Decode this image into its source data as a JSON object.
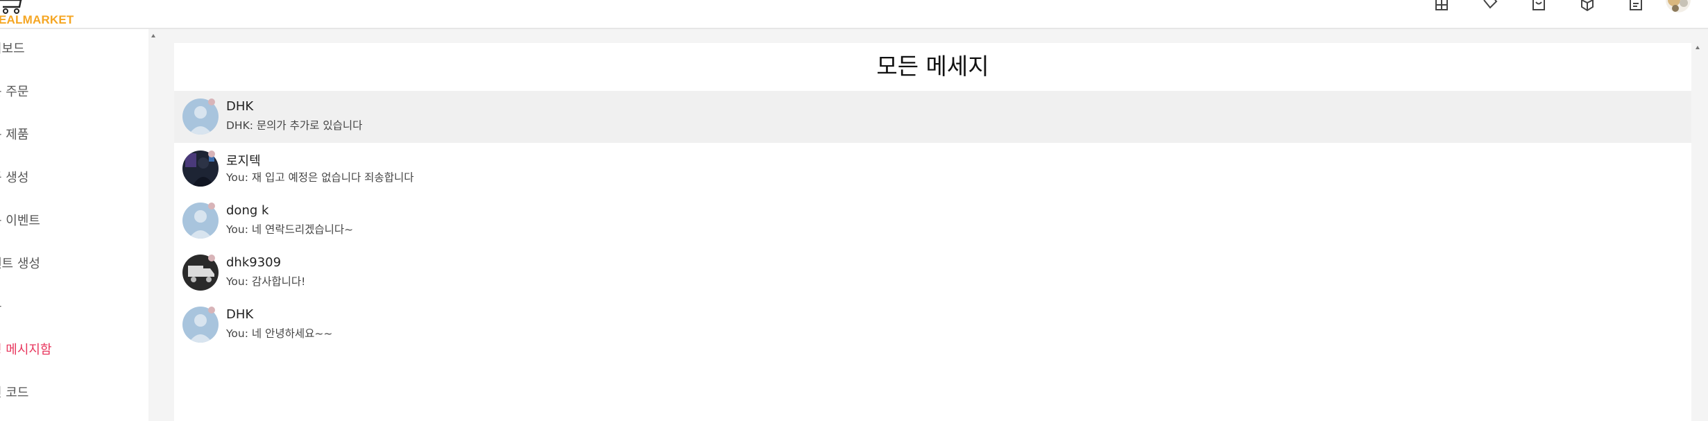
{
  "brand": {
    "logo_text": "EALMARKET",
    "accent": "#f5a623"
  },
  "topbar": {
    "icons": [
      "gift-icon",
      "tag-icon",
      "shopping-bag-icon",
      "box-icon",
      "document-icon"
    ],
    "avatar": "user-avatar"
  },
  "sidebar": {
    "items": [
      {
        "label": "시보드",
        "active": false
      },
      {
        "label": "든 주문",
        "active": false
      },
      {
        "label": "든 제품",
        "active": false
      },
      {
        "label": "품 생성",
        "active": false
      },
      {
        "label": "든 이벤트",
        "active": false
      },
      {
        "label": "벤트 생성",
        "active": false
      },
      {
        "label": "용",
        "active": false
      },
      {
        "label": "녕 메시지함",
        "active": true
      },
      {
        "label": "인 코드",
        "active": false
      }
    ],
    "active_color": "#e8365d"
  },
  "messages_panel": {
    "title": "모든 메세지",
    "items": [
      {
        "name": "DHK",
        "preview": "DHK: 문의가 추가로 있습니다",
        "avatar": "default-avatar",
        "selected": true
      },
      {
        "name": "로지텍",
        "preview": "You: 재 입고 예정은 없습니다 죄송합니다",
        "avatar": "photo-avatar",
        "selected": false
      },
      {
        "name": "dong k",
        "preview": "You: 네 연락드리겠습니다~",
        "avatar": "default-avatar",
        "selected": false
      },
      {
        "name": "dhk9309",
        "preview": "You: 감사합니다!",
        "avatar": "truck-avatar",
        "selected": false
      },
      {
        "name": "DHK",
        "preview": "You: 네 안녕하세요~~",
        "avatar": "default-avatar",
        "selected": false
      }
    ]
  }
}
